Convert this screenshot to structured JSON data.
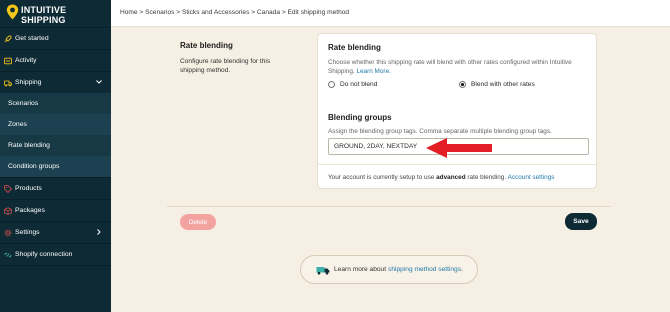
{
  "brand": {
    "line1": "INTUITIVE",
    "line2": "SHIPPING",
    "accent": "#f5c518"
  },
  "sidebar": {
    "items": [
      {
        "label": "Get started",
        "icon": "rocket-icon"
      },
      {
        "label": "Activity",
        "icon": "activity-icon"
      },
      {
        "label": "Shipping",
        "icon": "truck-icon"
      },
      {
        "label": "Scenarios"
      },
      {
        "label": "Zones"
      },
      {
        "label": "Rate blending"
      },
      {
        "label": "Condition groups"
      },
      {
        "label": "Products",
        "icon": "tag-icon"
      },
      {
        "label": "Packages",
        "icon": "package-icon"
      },
      {
        "label": "Settings",
        "icon": "gear-icon"
      },
      {
        "label": "Shopify connection",
        "icon": "link-icon"
      }
    ]
  },
  "breadcrumb": "Home > Scenarios > Sticks and Accessories > Canada > Edit shipping method",
  "section": {
    "title": "Rate blending",
    "description": "Configure rate blending for this shipping method."
  },
  "card": {
    "title": "Rate blending",
    "description": "Choose whether this shipping rate will blend with other rates configured within Intuitive Shipping.",
    "learn_more": "Learn More.",
    "radio_no": "Do not blend",
    "radio_yes": "Blend with other rates",
    "selected": "Blend with other rates",
    "groups_title": "Blending groups",
    "groups_desc": "Assign the blending group tags. Comma separate multiple blending group tags.",
    "groups_value": "GROUND, 2DAY, NEXTDAY",
    "footer_pre": "Your account is currently setup to use",
    "footer_bold": "advanced",
    "footer_mid": "rate blending.",
    "footer_link": "Account settings"
  },
  "actions": {
    "delete": "Delete",
    "save": "Save"
  },
  "learn": {
    "text": "Learn more about",
    "link": "shipping method settings",
    "suffix": "."
  },
  "colors": {
    "sidebar": "#0e2a35",
    "background": "#f6efe3",
    "link": "#1f7aa8",
    "arrow": "#e31e24",
    "delete": "#f2a3a0"
  }
}
